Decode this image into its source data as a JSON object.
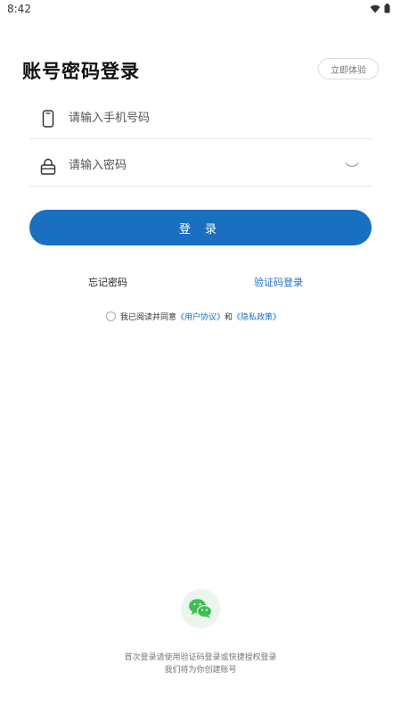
{
  "status_bar": {
    "time": "8:42"
  },
  "header": {
    "title": "账号密码登录",
    "try_label": "立即体验"
  },
  "form": {
    "phone_placeholder": "请输入手机号码",
    "password_placeholder": "请输入密码",
    "login_label": "登 录"
  },
  "links": {
    "forgot_password": "忘记密码",
    "sms_login": "验证码登录"
  },
  "agreement": {
    "prefix": "我已阅读并同意",
    "user_agreement": "《用户协议》",
    "conjunction": "和",
    "privacy_policy": "《隐私政策》"
  },
  "footer": {
    "line1": "首次登录请使用验证码登录或快捷授权登录",
    "line2": "我们将为你创建账号"
  },
  "colors": {
    "accent": "#1a6fc0",
    "wechat": "#3cc051"
  },
  "icons": {
    "phone": "phone-icon",
    "lock": "lock-icon",
    "eye": "eye-closed-icon",
    "wechat": "wechat-icon",
    "wifi": "wifi-icon",
    "battery": "battery-icon"
  }
}
